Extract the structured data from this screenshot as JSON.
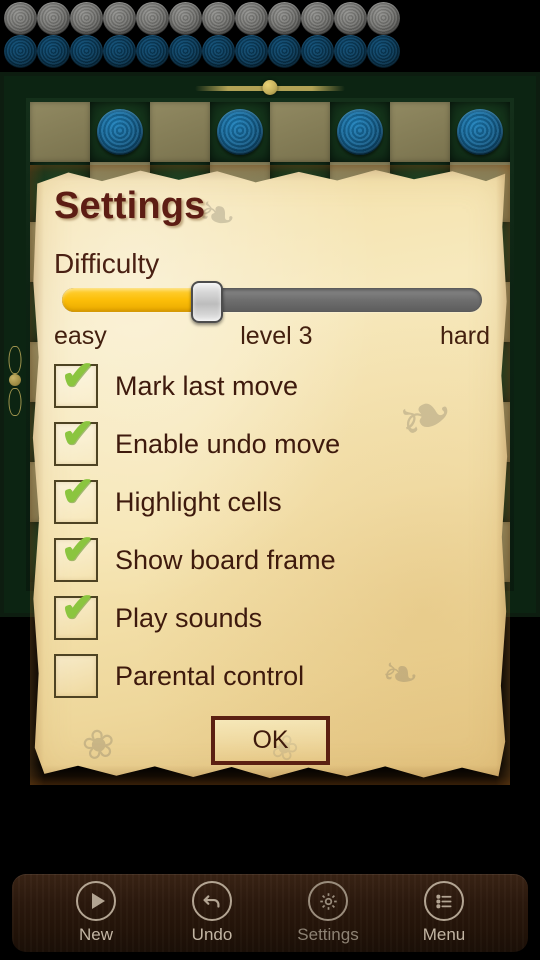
{
  "app": {
    "background_color": "#000000",
    "panel_color": "#f3dfa6"
  },
  "captured_tray": {
    "light_pieces_count": 12,
    "dark_pieces_count": 12,
    "light_piece_color": "#6f6f6c",
    "dark_piece_color": "#0a3753"
  },
  "board": {
    "frame_color": "#0e2414",
    "frame_accent_color": "#c4b05c",
    "light_square_color": "#8a8258",
    "dark_square_color": "#133119",
    "piece_color": "#15618f",
    "rows": [
      {
        "squares": [
          "light",
          "dark-piece",
          "light",
          "dark-piece",
          "light",
          "dark-piece",
          "light",
          "dark-piece"
        ]
      },
      {
        "squares": [
          "dark",
          "light",
          "dark",
          "light",
          "dark",
          "light",
          "dark",
          "light"
        ]
      },
      {
        "squares": [
          "light",
          "dark",
          "light",
          "dark",
          "light",
          "dark",
          "light",
          "dark"
        ]
      },
      {
        "squares": [
          "dark",
          "light",
          "dark",
          "light",
          "dark",
          "light",
          "dark",
          "light"
        ]
      },
      {
        "squares": [
          "light",
          "dark",
          "light",
          "dark",
          "light",
          "dark",
          "light",
          "dark"
        ]
      },
      {
        "squares": [
          "dark",
          "light",
          "dark",
          "light",
          "dark",
          "light",
          "dark",
          "light"
        ]
      },
      {
        "squares": [
          "light",
          "dark",
          "light",
          "dark",
          "light",
          "dark",
          "light",
          "dark"
        ]
      },
      {
        "squares": [
          "dark",
          "light",
          "dark",
          "light",
          "dark",
          "light",
          "dark",
          "light"
        ]
      }
    ]
  },
  "settings": {
    "title": "Settings",
    "difficulty_label": "Difficulty",
    "difficulty": {
      "min_label": "easy",
      "value_label": "level 3",
      "max_label": "hard",
      "percent": 33,
      "fill_color": "#fcbe08",
      "track_color": "#6f6f6f"
    },
    "options": [
      {
        "label": "Mark last move",
        "checked": true
      },
      {
        "label": "Enable undo move",
        "checked": true
      },
      {
        "label": "Highlight cells",
        "checked": true
      },
      {
        "label": "Show board frame",
        "checked": true
      },
      {
        "label": "Play sounds",
        "checked": true
      },
      {
        "label": "Parental control",
        "checked": false
      }
    ],
    "check_mark": "✔",
    "check_color": "#8bc53f",
    "ok_label": "OK"
  },
  "toolbar": {
    "items": [
      {
        "label": "New",
        "icon": "play-icon",
        "dim": false
      },
      {
        "label": "Undo",
        "icon": "undo-icon",
        "dim": false
      },
      {
        "label": "Settings",
        "icon": "gear-icon",
        "dim": true
      },
      {
        "label": "Menu",
        "icon": "list-icon",
        "dim": false
      }
    ]
  }
}
